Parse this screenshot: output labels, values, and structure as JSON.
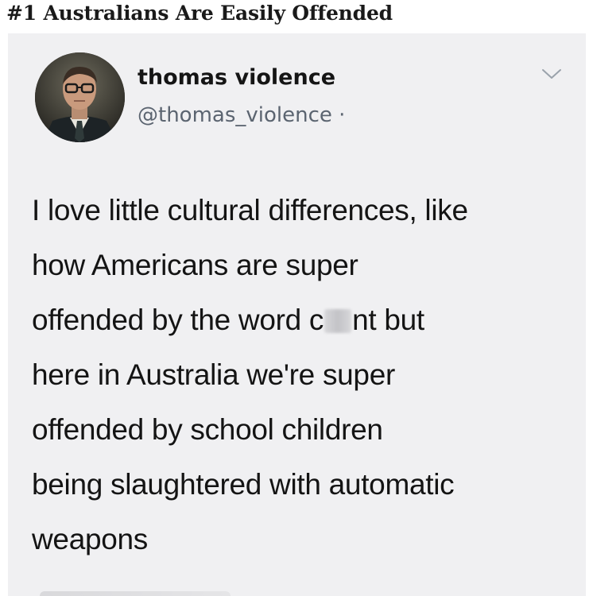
{
  "article": {
    "heading": "#1 Australians Are Easily Offended"
  },
  "tweet": {
    "display_name": "thomas violence",
    "handle": "@thomas_violence ·",
    "menu_icon": "chevron-down-icon",
    "avatar_icon": "profile-photo",
    "text_lines": [
      "I love little cultural differences, like",
      "how Americans are super",
      "offended by the word c",
      "nt but",
      "here in Australia we're super",
      "offended by school children",
      "being slaughtered with automatic",
      "weapons"
    ]
  },
  "colors": {
    "card_background": "#f0f0f2",
    "name_text": "#151515",
    "handle_text": "#5b6470",
    "body_text": "#141414",
    "heading_text": "#1a1a1a"
  }
}
